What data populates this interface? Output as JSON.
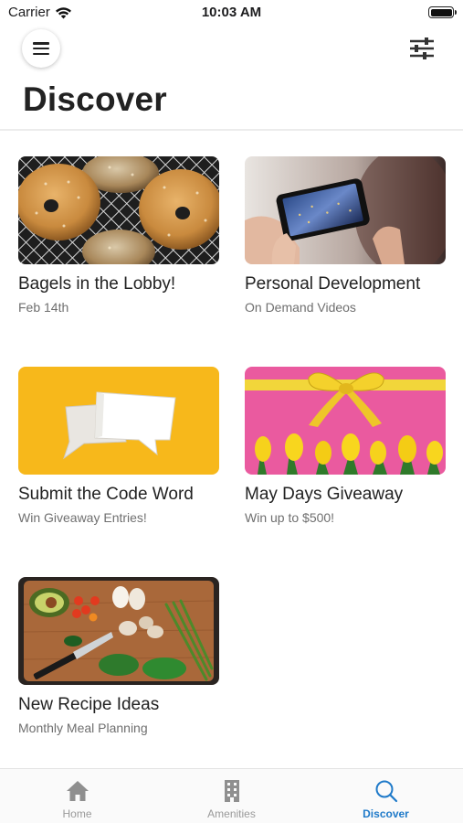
{
  "status_bar": {
    "carrier": "Carrier",
    "time": "10:03 AM",
    "icons": [
      "wifi-icon",
      "battery-icon"
    ]
  },
  "header": {
    "menu_icon": "hamburger-menu-icon",
    "filter_icon": "sliders-filter-icon",
    "title": "Discover"
  },
  "cards": [
    {
      "title": "Bagels in the Lobby!",
      "subtitle": "Feb 14th",
      "image": "bagels-photo"
    },
    {
      "title": "Personal Development",
      "subtitle": "On Demand Videos",
      "image": "phone-video-photo"
    },
    {
      "title": "Submit the Code Word",
      "subtitle": "Win Giveaway Entries!",
      "image": "speech-bubbles-photo"
    },
    {
      "title": "May Days Giveaway",
      "subtitle": "Win up to $500!",
      "image": "gift-ribbon-tulips-photo"
    },
    {
      "title": "New Recipe Ideas",
      "subtitle": "Monthly Meal Planning",
      "image": "vegetables-cutting-board-photo"
    }
  ],
  "tab_bar": {
    "tabs": [
      {
        "label": "Home",
        "icon": "home-icon",
        "active": false
      },
      {
        "label": "Amenities",
        "icon": "building-icon",
        "active": false
      },
      {
        "label": "Discover",
        "icon": "search-icon",
        "active": true
      }
    ]
  },
  "colors": {
    "accent": "#1f7ac9",
    "inactive_tab": "#9a9a9a",
    "title_text": "#222222",
    "subtitle_text": "#6f6f6f"
  }
}
